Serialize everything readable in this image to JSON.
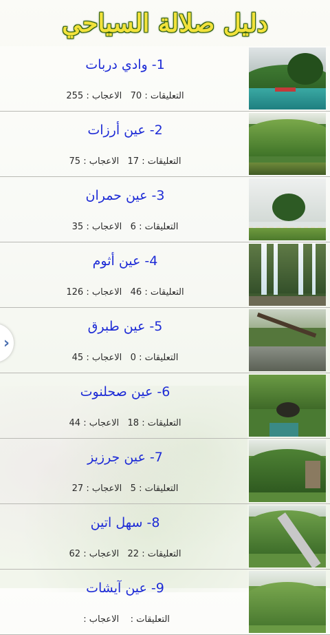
{
  "header": {
    "title": "دليل صلالة السياحي"
  },
  "labels": {
    "comments": "التعليقات :",
    "likes": "الاعجاب :"
  },
  "side_arrow": {
    "icon": "chevron-right-icon",
    "glyph": "›"
  },
  "places": [
    {
      "title": "1- وادي دربات",
      "comments": "70",
      "likes": "255",
      "image": "valley-river-boats-photo"
    },
    {
      "title": "2- عين أرزات",
      "comments": "17",
      "likes": "75",
      "image": "green-hills-pond-photo"
    },
    {
      "title": "3- عين حمران",
      "comments": "6",
      "likes": "35",
      "image": "tree-fence-fog-photo"
    },
    {
      "title": "4- عين أثوم",
      "comments": "46",
      "likes": "126",
      "image": "waterfalls-cliff-photo"
    },
    {
      "title": "5- عين طبرق",
      "comments": "0",
      "likes": "45",
      "image": "tree-stream-rocks-photo"
    },
    {
      "title": "6- عين صحلنوت",
      "comments": "18",
      "likes": "44",
      "image": "cave-pool-greenery-photo"
    },
    {
      "title": "7- عين جرزيز",
      "comments": "5",
      "likes": "27",
      "image": "mountain-valley-photo"
    },
    {
      "title": "8- سهل اتين",
      "comments": "22",
      "likes": "62",
      "image": "plain-road-cars-photo"
    },
    {
      "title": "9- عين آيشات",
      "comments": "",
      "likes": "",
      "image": "green-spring-photo"
    }
  ]
}
